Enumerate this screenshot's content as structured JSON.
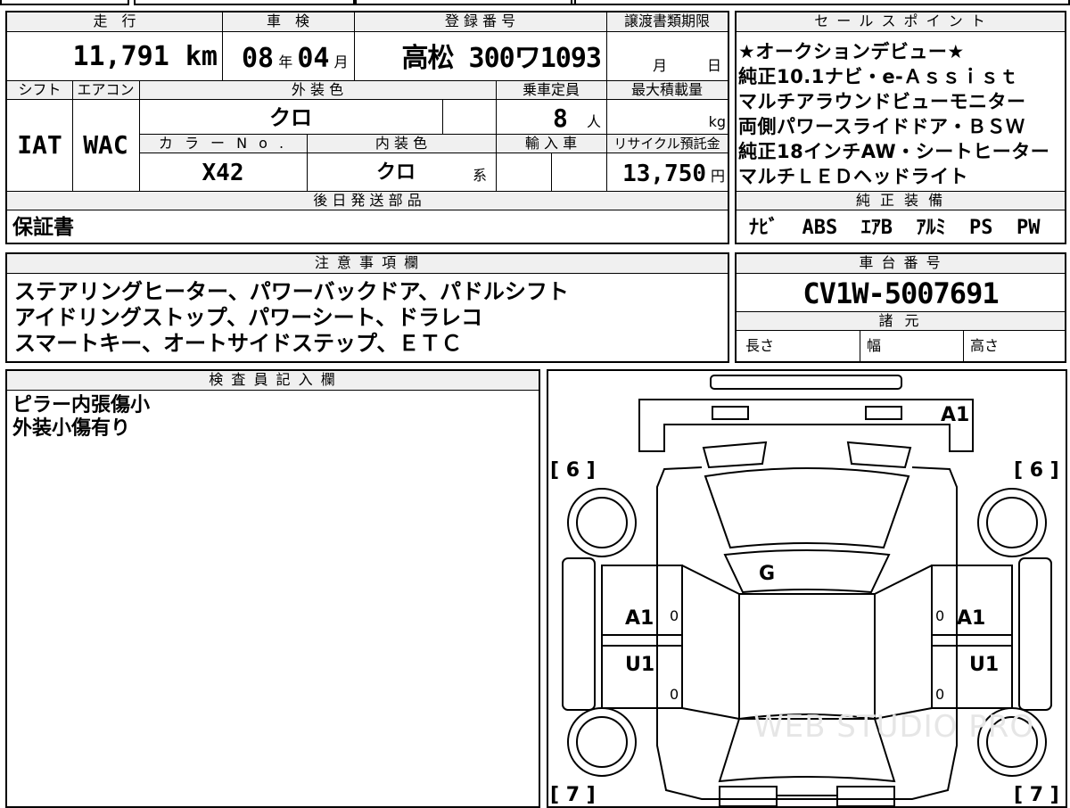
{
  "main_table": {
    "mileage": {
      "label": "走　行",
      "value": "11,791 km"
    },
    "inspection": {
      "label": "車　検",
      "year": "08",
      "year_unit": "年",
      "month": "04",
      "month_unit": "月"
    },
    "registration": {
      "label": "登 録 番 号",
      "value": "高松 300ワ1093"
    },
    "transfer_deadline": {
      "label": "譲渡書類期限",
      "month_unit": "月",
      "day_unit": "日"
    },
    "shift": {
      "label": "シフト",
      "value": "IAT"
    },
    "aircon": {
      "label": "エアコン",
      "value": "WAC"
    },
    "exterior_color": {
      "label": "外 装 色",
      "value": "クロ"
    },
    "capacity": {
      "label": "乗車定員",
      "value": "8",
      "unit": "人"
    },
    "max_load": {
      "label": "最大積載量",
      "unit": "kg"
    },
    "color_no": {
      "label": "カ ラ ー N o .",
      "value": "X42"
    },
    "interior_color": {
      "label": "内 装 色",
      "value": "クロ",
      "suffix": "系"
    },
    "import": {
      "label": "輸 入 車"
    },
    "recycle": {
      "label": "リサイクル預託金",
      "value": "13,750",
      "unit": "円"
    },
    "later_parts": {
      "label": "後 日 発 送 部 品",
      "value": "保証書"
    }
  },
  "sales_points": {
    "label": "セ ー ル ス ポ イ ン ト",
    "lines": [
      "★オークションデビュー★",
      "純正10.1ナビ・e-Ａｓｓｉｓｔ",
      "マルチアラウンドビューモニター",
      "両側パワースライドドア・ＢＳＷ",
      "純正18インチAW・シートヒーター",
      "マルチＬＥＤヘッドライト"
    ]
  },
  "equipment": {
    "label": "純 正 装 備",
    "items": [
      "ﾅﾋﾞ",
      "ABS",
      "ｴｱB",
      "ｱﾙﾐ",
      "PS",
      "PW"
    ]
  },
  "notes": {
    "label": "注 意 事 項 欄",
    "lines": [
      "ステアリングヒーター、パワーバックドア、パドルシフト",
      "アイドリングストップ、パワーシート、ドラレコ",
      "スマートキー、オートサイドステップ、ＥＴＣ"
    ]
  },
  "chassis": {
    "label": "車 台 番 号",
    "value": "CV1W-5007691"
  },
  "specs": {
    "label": "諸 元",
    "length": "長さ",
    "width": "幅",
    "height": "高さ"
  },
  "inspector": {
    "label": "検 査 員 記 入 欄",
    "lines": [
      "ピラー内張傷小",
      "外装小傷有り"
    ]
  },
  "diagram": {
    "marks": {
      "rear_top": "A1",
      "left_front_fender": "[ 6 ]",
      "right_front_fender": "[ 6 ]",
      "left_rear": "[ 7 ]",
      "right_rear": "[ 7 ]",
      "roof": "G",
      "left_front_door": "A1",
      "right_front_door": "A1",
      "left_rear_door": "U1",
      "right_rear_door": "U1",
      "zero": "0"
    },
    "watermark": "WEB STUDIO PRO"
  }
}
